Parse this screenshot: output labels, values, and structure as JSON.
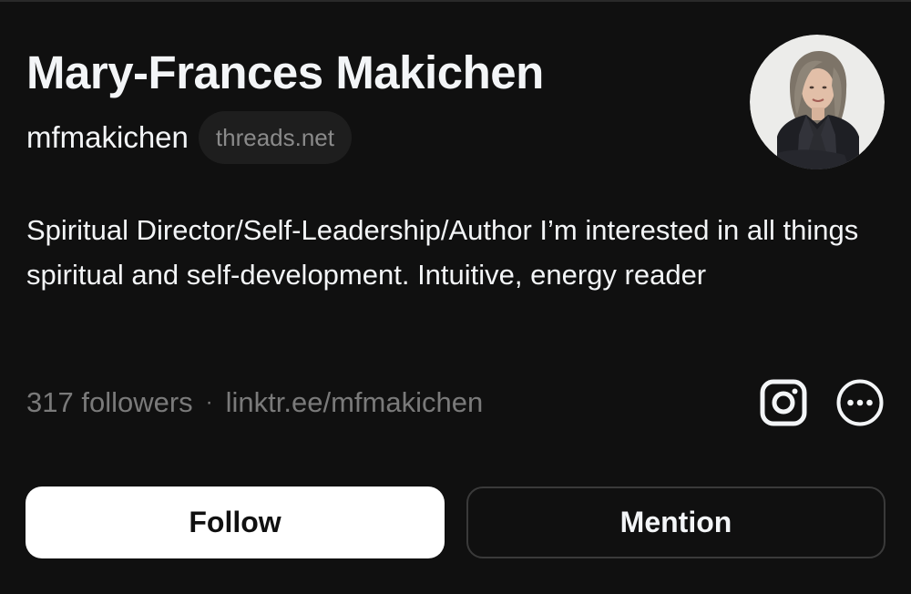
{
  "profile": {
    "name": "Mary-Frances Makichen",
    "username": "mfmakichen",
    "domain_badge": "threads.net",
    "bio": "Spiritual Director/Self-Leadership/Author I’m interested in all things spiritual and self-development. Intuitive, energy reader",
    "followers": "317 followers",
    "separator": "·",
    "link": "linktr.ee/mfmakichen"
  },
  "icons": {
    "instagram": "instagram-icon",
    "more": "more-options-icon"
  },
  "actions": {
    "follow_label": "Follow",
    "mention_label": "Mention"
  },
  "colors": {
    "background": "#101010",
    "text_primary": "#f3f5f7",
    "text_secondary": "#7a7a7a",
    "follow_bg": "#ffffff",
    "mention_border": "#3a3a3a"
  }
}
